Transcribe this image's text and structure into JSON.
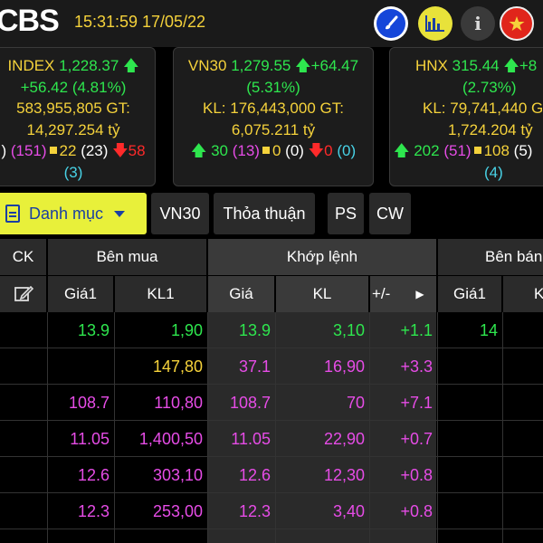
{
  "header": {
    "logo": "CBS",
    "time": "15:31:59",
    "date": "17/05/22",
    "buttons": {
      "theme": "brush-icon",
      "chart": "bar-chart-icon",
      "info": "i",
      "language": "vietnam-flag-icon"
    }
  },
  "indices": [
    {
      "line1_name": "INDEX",
      "line1_value": "1,228.37",
      "line2_change": "+56.42",
      "line2_pct": "(4.81%)",
      "line3": "583,955,805 GT:",
      "line4": "14,297.254 tỷ",
      "up_paren": "(151)",
      "ref": "22",
      "ref_paren": "(23)",
      "down": "58",
      "down_paren": "(3)"
    },
    {
      "line1_name": "VN30",
      "line1_value": "1,279.55",
      "line1_change": "+64.47",
      "line2_pct": "(5.31%)",
      "line3": "KL: 176,443,000 GT:",
      "line4": "6,075.211 tỷ",
      "up": "30",
      "up_paren": "(13)",
      "ref": "0",
      "ref_paren": "(0)",
      "down": "0",
      "down_paren": "(0)"
    },
    {
      "line1_name": "HNX",
      "line1_value": "315.44",
      "line1_change": "+8",
      "line2_pct": "(2.73%)",
      "line3": "KL: 79,741,440 G",
      "line4": "1,724.204 tỷ",
      "up": "202",
      "up_paren": "(51)",
      "ref": "108",
      "ref_paren": "(5)",
      "down_paren": "(4)"
    }
  ],
  "tabs": {
    "active": "Danh mục",
    "items": [
      "VN30",
      "Thỏa thuận",
      "PS",
      "CW"
    ]
  },
  "table": {
    "headers": {
      "ck": "CK",
      "ben_mua": "Bên mua",
      "khop_lenh": "Khớp lệnh",
      "ben_ban": "Bên bán",
      "gia1": "Giá1",
      "kl1": "KL1",
      "gia": "Giá",
      "kl": "KL",
      "change": "+/-",
      "gia1_ban": "Giá1",
      "kl1_ban": "K"
    },
    "rows": [
      {
        "buy_price": "13.9",
        "buy_vol": "1,90",
        "match_price": "13.9",
        "match_vol": "3,10",
        "change": "+1.1",
        "sell_price": "14",
        "color": "#2ee64e",
        "vol_color": "#2ee64e"
      },
      {
        "buy_price": "",
        "buy_vol": "147,80",
        "match_price": "37.1",
        "match_vol": "16,90",
        "change": "+3.3",
        "sell_price": "",
        "color": "#e64ce6",
        "vol_color": "#f5d23b"
      },
      {
        "buy_price": "108.7",
        "buy_vol": "110,80",
        "match_price": "108.7",
        "match_vol": "70",
        "change": "+7.1",
        "sell_price": "",
        "color": "#e64ce6",
        "vol_color": "#e64ce6"
      },
      {
        "buy_price": "11.05",
        "buy_vol": "1,400,50",
        "match_price": "11.05",
        "match_vol": "22,90",
        "change": "+0.7",
        "sell_price": "",
        "color": "#e64ce6",
        "vol_color": "#e64ce6"
      },
      {
        "buy_price": "12.6",
        "buy_vol": "303,10",
        "match_price": "12.6",
        "match_vol": "12,30",
        "change": "+0.8",
        "sell_price": "",
        "color": "#e64ce6",
        "vol_color": "#e64ce6"
      },
      {
        "buy_price": "12.3",
        "buy_vol": "253,00",
        "match_price": "12.3",
        "match_vol": "3,40",
        "change": "+0.8",
        "sell_price": "",
        "color": "#e64ce6",
        "vol_color": "#e64ce6"
      }
    ]
  }
}
